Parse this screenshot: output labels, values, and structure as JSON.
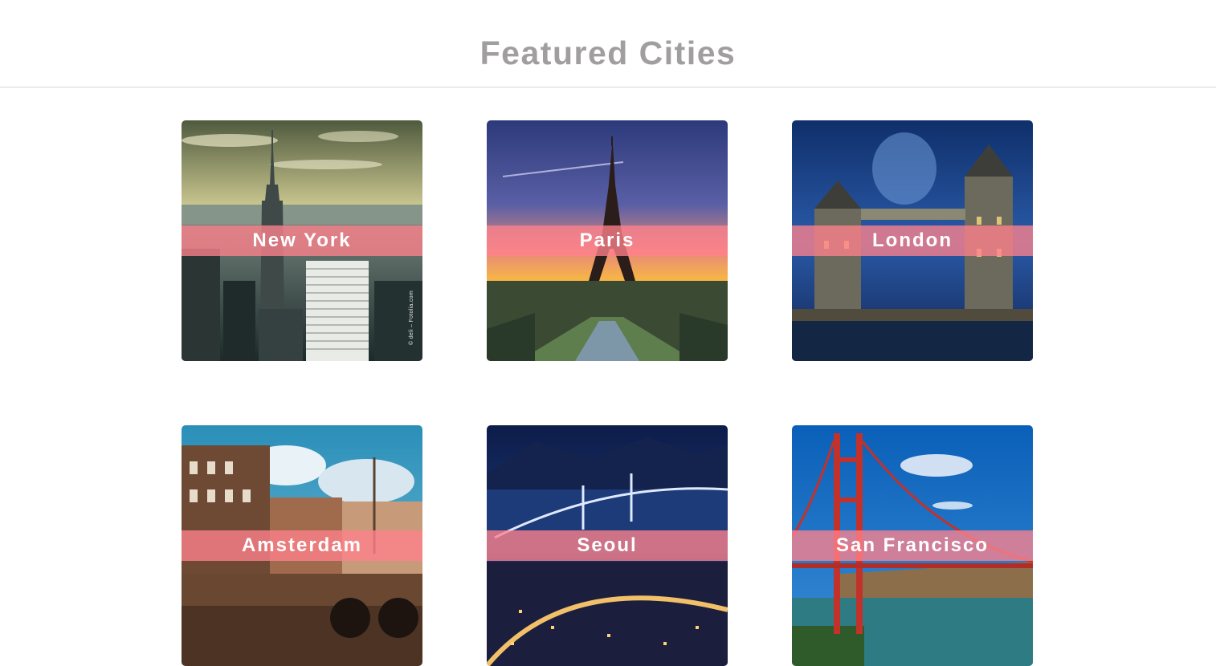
{
  "header": {
    "title": "Featured Cities"
  },
  "cities": [
    {
      "name": "New York",
      "photo_credit": "© deli – Fotolia.com"
    },
    {
      "name": "Paris"
    },
    {
      "name": "London"
    },
    {
      "name": "Amsterdam"
    },
    {
      "name": "Seoul"
    },
    {
      "name": "San Francisco"
    }
  ],
  "colors": {
    "title": "#a09e9e",
    "label_band": "#ff828c",
    "label_text": "#ffffff",
    "divider": "#d6d6d6"
  }
}
